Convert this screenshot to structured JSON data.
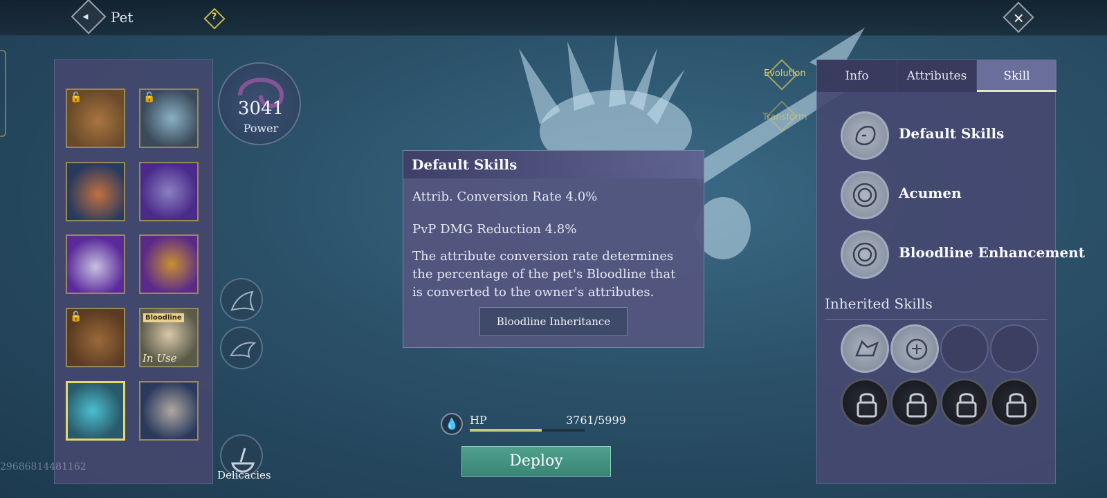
{
  "header": {
    "title": "Pet",
    "help_icon": "question-icon",
    "back_icon": "back-arrow-icon",
    "close_icon": "close-icon"
  },
  "pets": [
    {
      "name": "lion-pet",
      "locked": true,
      "selected": false,
      "colors": [
        "#6a4a2a",
        "#a8753f"
      ]
    },
    {
      "name": "ice-dragon-pet",
      "locked": true,
      "selected": false,
      "colors": [
        "#3a4a5a",
        "#8ab0c4"
      ]
    },
    {
      "name": "fire-beast-pet",
      "locked": false,
      "selected": false,
      "colors": [
        "#2a3a5e",
        "#c27040"
      ]
    },
    {
      "name": "shadow-wolf-pet",
      "locked": false,
      "selected": false,
      "colors": [
        "#4a2a8a",
        "#8a80c0"
      ]
    },
    {
      "name": "white-lion-pet",
      "locked": false,
      "selected": false,
      "colors": [
        "#5a2a9a",
        "#c8c0e0"
      ]
    },
    {
      "name": "golden-dragon-pet",
      "locked": false,
      "selected": false,
      "colors": [
        "#5a2a8a",
        "#c89030"
      ]
    },
    {
      "name": "brown-beast-pet",
      "locked": true,
      "selected": false,
      "colors": [
        "#5a3a22",
        "#9a6a3a"
      ]
    },
    {
      "name": "bloodline-girl-pet",
      "locked": false,
      "selected": false,
      "tag": "Bloodline",
      "status": "In Use",
      "colors": [
        "#5a5a4a",
        "#d8c8a8"
      ]
    },
    {
      "name": "azure-dragon-pet",
      "locked": false,
      "selected": true,
      "colors": [
        "#2a5a6a",
        "#4ac0d0"
      ]
    },
    {
      "name": "gryphon-pet",
      "locked": false,
      "selected": false,
      "colors": [
        "#2a3a5e",
        "#b0a8a0"
      ]
    }
  ],
  "uid_text": "29686814481162",
  "power": {
    "value": "3041",
    "label": "Power"
  },
  "delicacies_label": "Delicacies",
  "side_icons": [
    "flame-bird-icon",
    "bird-icon",
    "delicacies-icon"
  ],
  "evolution": {
    "label1": "Evolution",
    "label2": "Transform"
  },
  "tooltip": {
    "title": "Default Skills",
    "line1": "Attrib. Conversion Rate 4.0%",
    "line2": "PvP DMG Reduction 4.8%",
    "description": "The attribute conversion rate determines the percentage of the pet's Bloodline that is converted to the owner's attributes.",
    "button": "Bloodline Inheritance"
  },
  "hp": {
    "label": "HP",
    "value": "3761/5999",
    "fraction": 0.627,
    "icon": "droplet-icon"
  },
  "deploy_label": "Deploy",
  "tabs": [
    {
      "label": "Info",
      "active": false
    },
    {
      "label": "Attributes",
      "active": false
    },
    {
      "label": "Skill",
      "active": true
    }
  ],
  "skills": [
    {
      "label": "Default Skills",
      "icon": "lion-head-icon"
    },
    {
      "label": "Acumen",
      "icon": "swirl-icon"
    },
    {
      "label": "Bloodline Enhancement",
      "icon": "swirl-icon"
    }
  ],
  "inherited": {
    "title": "Inherited Skills",
    "slots": [
      {
        "type": "filled",
        "icon": "wolf-icon"
      },
      {
        "type": "filled",
        "icon": "lion-icon"
      },
      {
        "type": "empty"
      },
      {
        "type": "empty"
      },
      {
        "type": "locked",
        "icon": "lock-icon"
      },
      {
        "type": "locked",
        "icon": "lock-icon"
      },
      {
        "type": "locked",
        "icon": "lock-icon"
      },
      {
        "type": "locked",
        "icon": "lock-icon"
      }
    ]
  }
}
